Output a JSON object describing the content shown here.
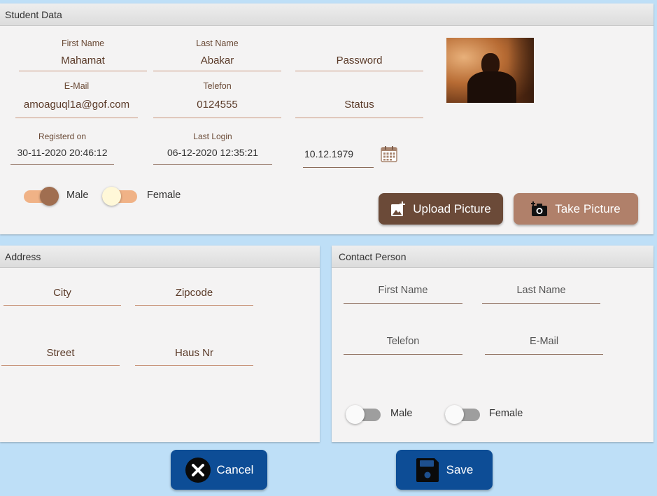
{
  "student": {
    "title": "Student Data",
    "first_name": {
      "label": "First Name",
      "value": "Mahamat"
    },
    "last_name": {
      "label": "Last Name",
      "value": "Abakar"
    },
    "password": {
      "placeholder": "Password"
    },
    "email": {
      "label": "E-Mail",
      "value": "amoaguql1a@gof.com"
    },
    "telefon": {
      "label": "Telefon",
      "value": "0124555"
    },
    "status": {
      "placeholder": "Status"
    },
    "registered": {
      "label": "Registerd on",
      "value": "30-11-2020 20:46:12"
    },
    "last_login": {
      "label": "Last Login",
      "value": "06-12-2020 12:35:21"
    },
    "birthdate": {
      "value": "10.12.1979"
    },
    "gender": {
      "male_label": "Male",
      "female_label": "Female",
      "male_on": true
    },
    "upload_label": "Upload Picture",
    "take_label": "Take Picture"
  },
  "address": {
    "title": "Address",
    "city": "City",
    "zipcode": "Zipcode",
    "street": "Street",
    "haus_nr": "Haus Nr"
  },
  "contact": {
    "title": "Contact Person",
    "first_name": "First Name",
    "last_name": "Last Name",
    "telefon": "Telefon",
    "email": "E-Mail",
    "male_label": "Male",
    "female_label": "Female"
  },
  "actions": {
    "cancel_label": "Cancel",
    "save_label": "Save"
  },
  "colors": {
    "background": "#bedff7",
    "accent_brown": "#6b4a38",
    "accent_tan": "#b0806a",
    "button_blue": "#0d4d96"
  }
}
